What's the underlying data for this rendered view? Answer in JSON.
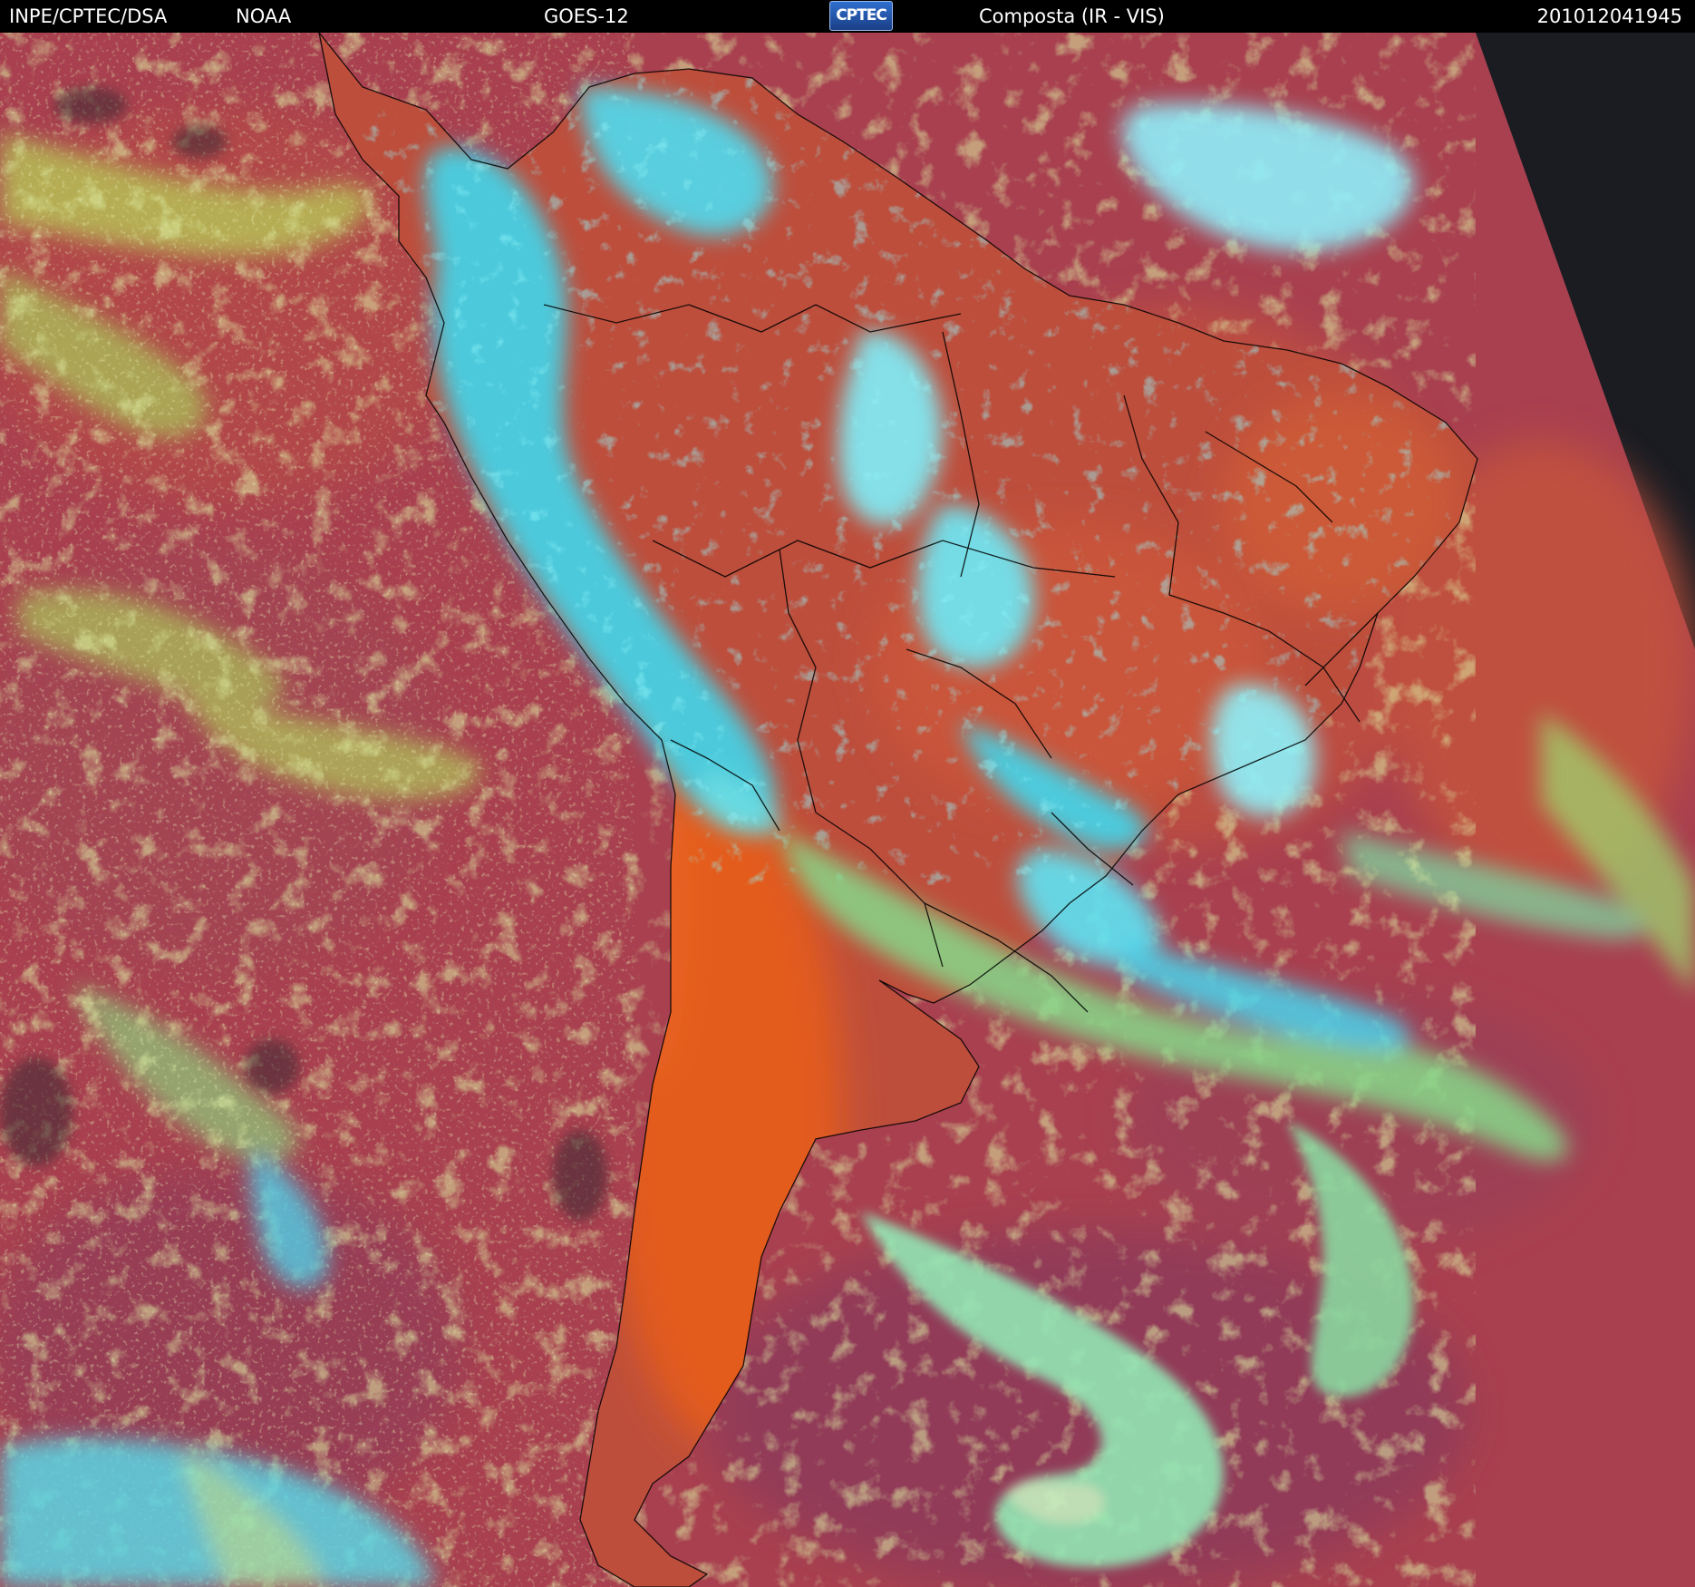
{
  "header": {
    "agency": "INPE/CPTEC/DSA",
    "source": "NOAA",
    "satellite": "GOES-12",
    "logo_text": "CPTEC",
    "product": "Composta (IR - VIS)",
    "timestamp": "201012041945"
  },
  "imagery": {
    "subject": "south-america-composite",
    "colors": {
      "ocean_clear": "#a8404f",
      "land_warm": "#d9571f",
      "cloud_high": "#3fe8f2",
      "cloud_low": "#b6d35a",
      "night_side": "#1a1c22",
      "borders": "#000000"
    }
  }
}
